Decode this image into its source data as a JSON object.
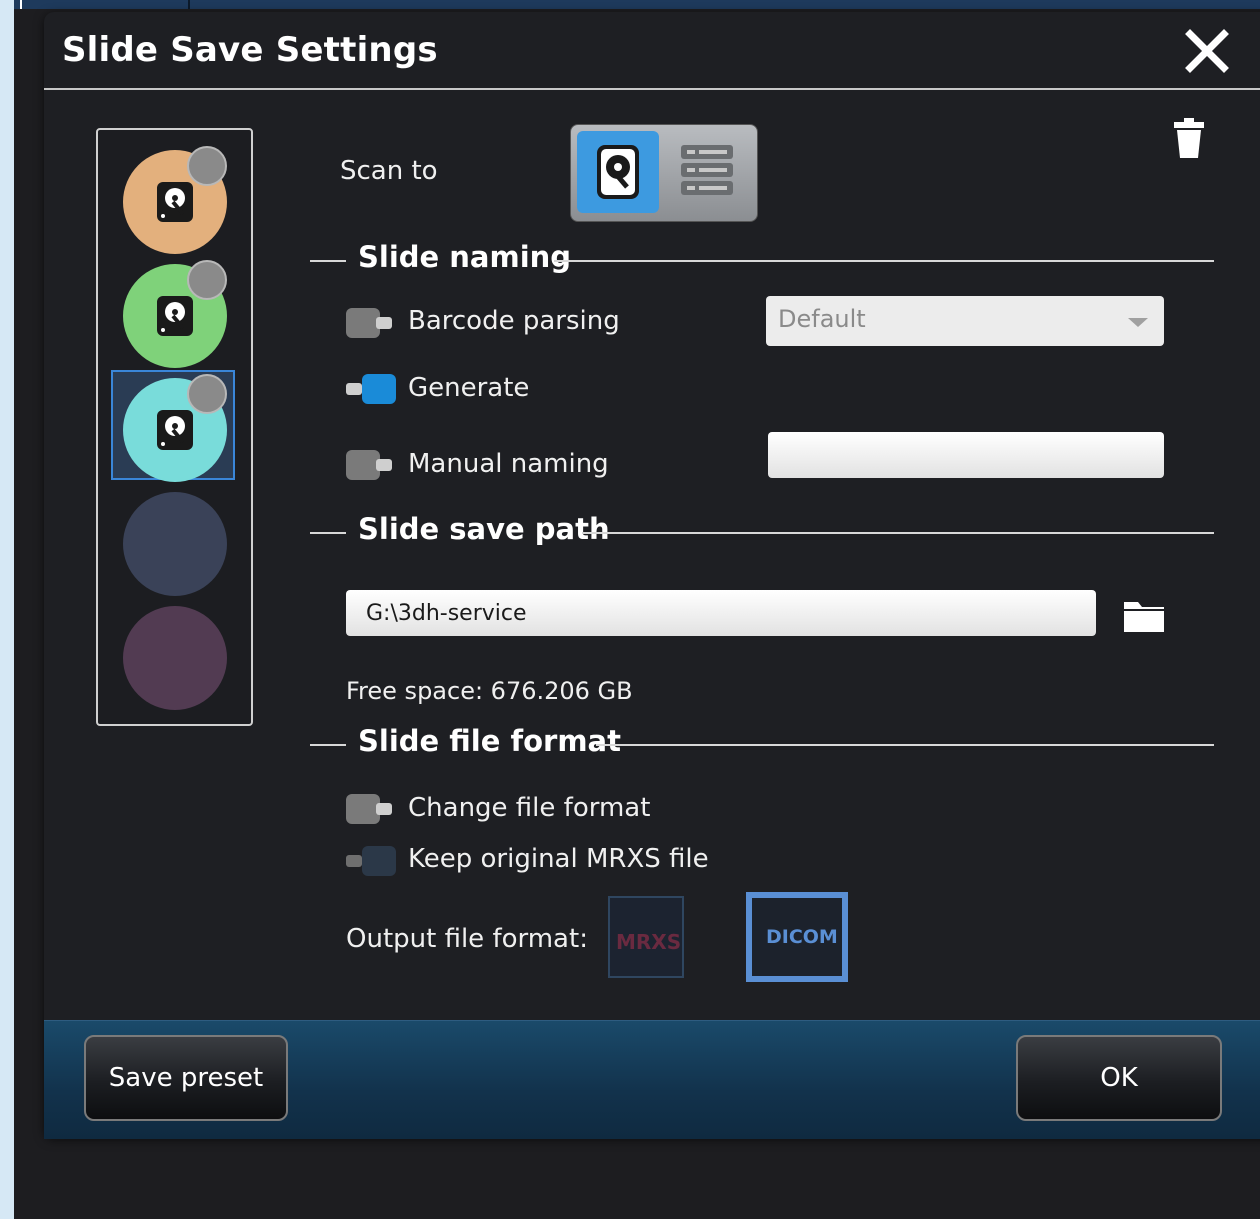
{
  "dialog": {
    "title": "Slide Save Settings"
  },
  "presets": [
    {
      "color": "#e3b07d",
      "icon": "hard-drive-icon",
      "selected": false
    },
    {
      "color": "#7fd27a",
      "icon": "hard-drive-icon",
      "selected": false
    },
    {
      "color": "#79dcda",
      "icon": "hard-drive-icon",
      "selected": true
    },
    {
      "color": "#3a4258",
      "icon": "",
      "selected": false
    },
    {
      "color": "#523b52",
      "icon": "",
      "selected": false
    }
  ],
  "scan_to": {
    "label": "Scan to",
    "options": [
      "hard-drive-icon",
      "server-icon"
    ],
    "selected": "hard-drive-icon"
  },
  "slide_naming": {
    "heading": "Slide naming",
    "barcode_parsing": {
      "label": "Barcode parsing",
      "enabled": false,
      "dropdown_value": "Default"
    },
    "generate": {
      "label": "Generate",
      "enabled": true
    },
    "manual_naming": {
      "label": "Manual naming",
      "enabled": false,
      "value": ""
    }
  },
  "slide_save_path": {
    "heading": "Slide save path",
    "path": "G:\\3dh-service",
    "free_space": "Free space: 676.206 GB"
  },
  "slide_file_format": {
    "heading": "Slide file format",
    "change_format": {
      "label": "Change file format",
      "enabled": false
    },
    "keep_original": {
      "label": "Keep original MRXS file",
      "enabled": false
    },
    "output_label": "Output file format:",
    "formats": [
      "MRXS",
      "DICOM"
    ],
    "selected_format": "DICOM"
  },
  "footer": {
    "save_preset": "Save preset",
    "ok": "OK"
  },
  "colors": {
    "accent": "#1a8bd8",
    "selection": "#3a86d8",
    "footer": "#153d5a"
  }
}
